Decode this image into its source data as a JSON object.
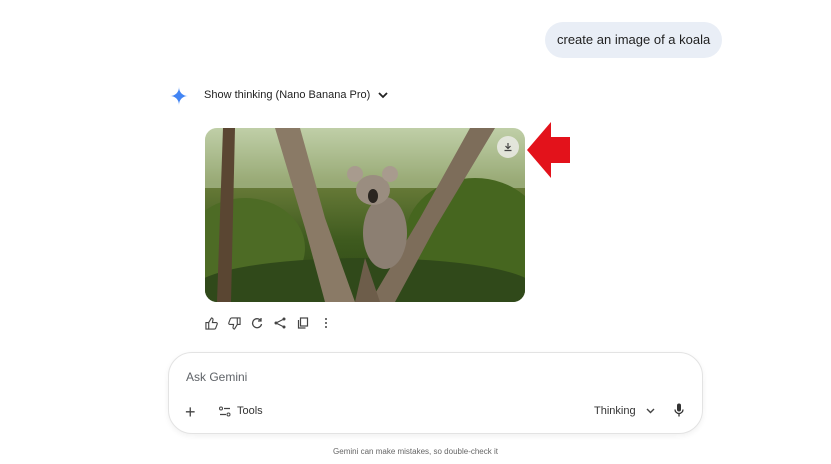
{
  "user_message": "create an image of a koala",
  "response": {
    "thinking_label": "Show thinking (Nano Banana Pro)"
  },
  "composer": {
    "placeholder": "Ask Gemini",
    "tools_label": "Tools",
    "model_label": "Thinking"
  },
  "disclaimer": "Gemini can make mistakes, so double-check it",
  "colors": {
    "accent": "#4285f4",
    "arrow": "#e3121b",
    "bubble": "#e9eef6"
  }
}
